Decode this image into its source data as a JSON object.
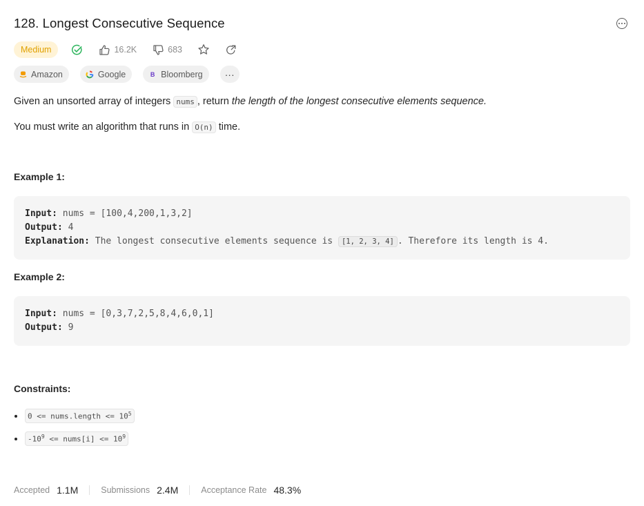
{
  "problem": {
    "title": "128. Longest Consecutive Sequence",
    "difficulty": "Medium",
    "likes": "16.2K",
    "dislikes": "683",
    "colors": {
      "difficulty_bg": "#fff3d6",
      "difficulty_text": "#e0a100",
      "solved_check": "#2db55d"
    },
    "icons": [
      "check-circle-icon",
      "thumbs-up-icon",
      "thumbs-down-icon",
      "star-icon",
      "share-icon",
      "more-icon"
    ]
  },
  "tags": [
    {
      "label": "Amazon",
      "icon": "amazon-logo"
    },
    {
      "label": "Google",
      "icon": "google-logo"
    },
    {
      "label": "Bloomberg",
      "icon": "bloomberg-logo"
    },
    {
      "label": "···",
      "icon": "ellipsis"
    }
  ],
  "description": {
    "p1_before": "Given an unsorted array of integers ",
    "p1_code": "nums",
    "p1_mid": ", return ",
    "p1_italic": "the length of the longest consecutive elements sequence.",
    "p2_before": "You must write an algorithm that runs in ",
    "p2_code": "O(n)",
    "p2_after": " time."
  },
  "examples": [
    {
      "heading": "Example 1:",
      "input_label": "Input:",
      "input": "nums = [100,4,200,1,3,2]",
      "output_label": "Output:",
      "output": "4",
      "explanation_label": "Explanation:",
      "explanation_before": "The longest consecutive elements sequence is ",
      "explanation_code": "[1, 2, 3, 4]",
      "explanation_after": ". Therefore its length is 4."
    },
    {
      "heading": "Example 2:",
      "input_label": "Input:",
      "input": "nums = [0,3,7,2,5,8,4,6,0,1]",
      "output_label": "Output:",
      "output": "9"
    }
  ],
  "constraints": {
    "heading": "Constraints:",
    "c1_text": "0 <= nums.length <= 10",
    "c1_sup": "5",
    "c2_pre": "-10",
    "c2_sup1": "9",
    "c2_mid": " <= nums[i] <= 10",
    "c2_sup2": "9"
  },
  "stats": {
    "accepted_label": "Accepted",
    "accepted_value": "1.1M",
    "submissions_label": "Submissions",
    "submissions_value": "2.4M",
    "rate_label": "Acceptance Rate",
    "rate_value": "48.3%"
  }
}
